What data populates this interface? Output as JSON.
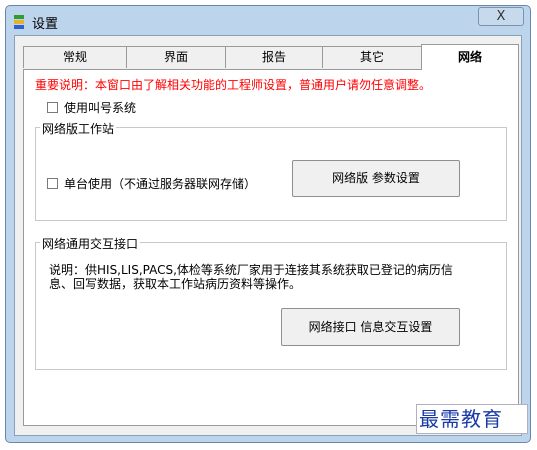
{
  "window": {
    "title": "设置",
    "close_label": "X"
  },
  "tabs": [
    {
      "label": "常规",
      "active": false
    },
    {
      "label": "界面",
      "active": false
    },
    {
      "label": "报告",
      "active": false
    },
    {
      "label": "其它",
      "active": false
    },
    {
      "label": "网络",
      "active": true
    }
  ],
  "panel": {
    "notice": "重要说明：本窗口由了解相关功能的工程师设置，普通用户请勿任意调整。",
    "use_call_system": {
      "label": "使用叫号系统",
      "checked": false
    },
    "network_workstation": {
      "group_title": "网络版工作站",
      "standalone": {
        "label": "单台使用（不通过服务器联网存储）",
        "checked": false
      },
      "settings_button": "网络版 参数设置"
    },
    "interface": {
      "group_title": "网络通用交互接口",
      "description": "说明：供HIS,LIS,PACS,体检等系统厂家用于连接其系统获取已登记的病历信息、回写数据，获取本工作站病历资料等操作。",
      "settings_button": "网络接口 信息交互设置"
    }
  },
  "watermark": "最需教育",
  "colors": {
    "notice_red": "#ff0000",
    "title_bar": "#bcd4ec",
    "watermark_blue": "#1a3aa8"
  }
}
